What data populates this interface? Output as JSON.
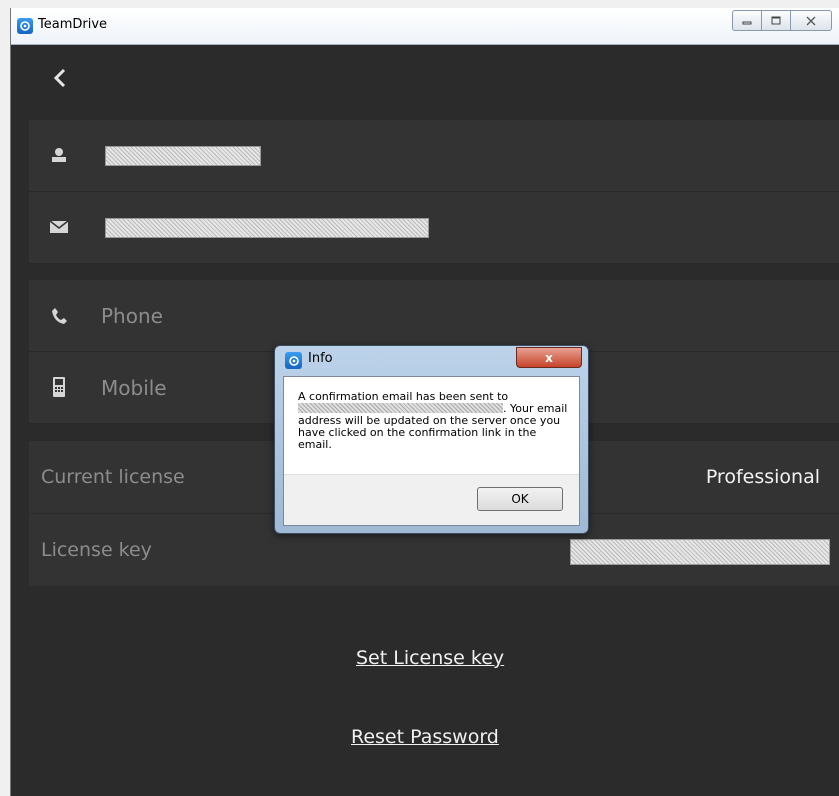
{
  "window": {
    "title": "TeamDrive"
  },
  "icons": {
    "app": "teamdrive-icon",
    "back": "back-arrow-icon",
    "user": "user-icon",
    "email": "envelope-icon",
    "phone": "phone-icon",
    "mobile": "mobile-icon"
  },
  "profile": {
    "phone_label": "Phone",
    "mobile_label": "Mobile"
  },
  "license": {
    "current_label": "Current license",
    "current_value": "Professional",
    "key_label": "License key"
  },
  "links": {
    "set_license_key": "Set License key",
    "reset_password": "Reset Password"
  },
  "dialog": {
    "title": "Info",
    "close": "x",
    "message_line1": "A confirmation email has been sent to",
    "message_rest": ". Your email address will be updated on the server once you have clicked on the confirmation link in the email.",
    "ok": "OK"
  },
  "colors": {
    "background": "#2b2b2b",
    "row": "#333333",
    "muted_text": "#8c8c8c",
    "accent_icon": "#1e88e5"
  }
}
